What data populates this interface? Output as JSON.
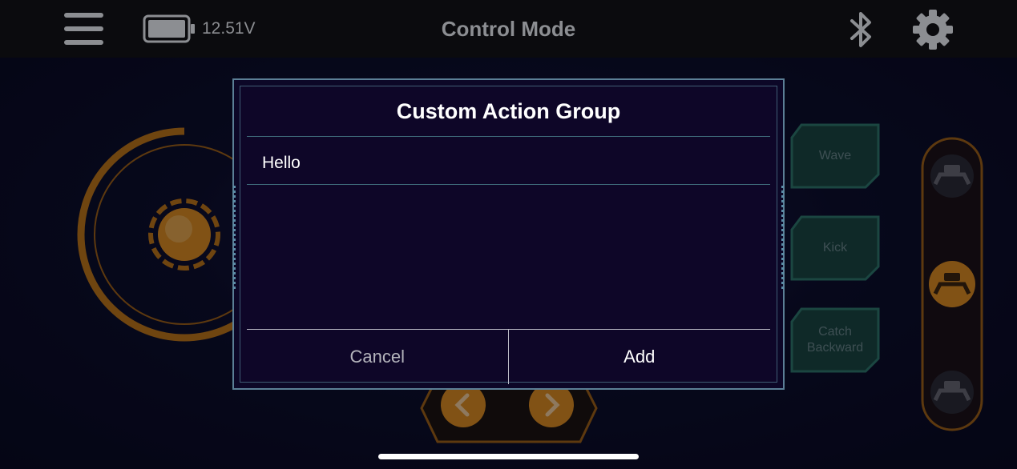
{
  "header": {
    "title": "Control Mode",
    "battery_voltage": "12.51V",
    "menu_icon": "hamburger-menu-icon",
    "bluetooth_icon": "bluetooth-icon",
    "settings_icon": "gear-icon"
  },
  "actions": [
    {
      "label": "Wave"
    },
    {
      "label": "Kick"
    },
    {
      "label": "Catch Backward"
    }
  ],
  "dialog": {
    "title": "Custom Action Group",
    "input_value": "Hello",
    "cancel_label": "Cancel",
    "add_label": "Add"
  },
  "colors": {
    "accent_orange": "#e8931a",
    "action_teal": "#2f7d6a",
    "dialog_bg": "#0e0628"
  }
}
